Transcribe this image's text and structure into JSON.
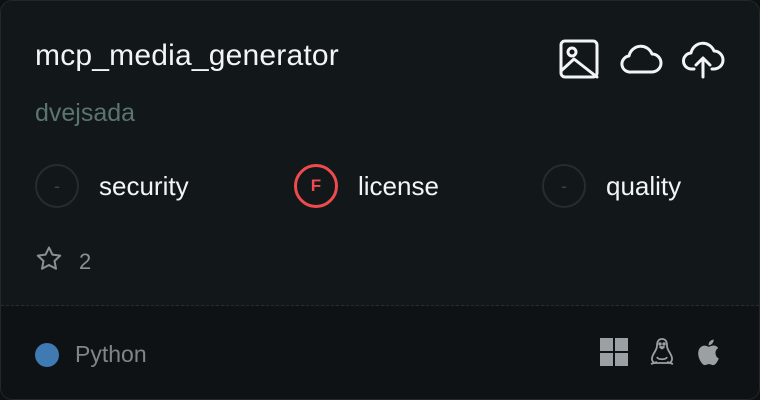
{
  "server": {
    "name": "mcp_media_generator",
    "author": "dvejsada"
  },
  "top_icons": [
    "image-icon",
    "cloud-icon",
    "cloud-upload-icon"
  ],
  "scores": [
    {
      "label": "security",
      "grade": "-",
      "status": "none"
    },
    {
      "label": "license",
      "grade": "F",
      "status": "fail"
    },
    {
      "label": "quality",
      "grade": "-",
      "status": "none"
    }
  ],
  "stars": {
    "count": "2"
  },
  "footer": {
    "language": "Python",
    "language_color": "#3f7ab3",
    "platforms": [
      "windows-icon",
      "linux-icon",
      "apple-icon"
    ]
  }
}
